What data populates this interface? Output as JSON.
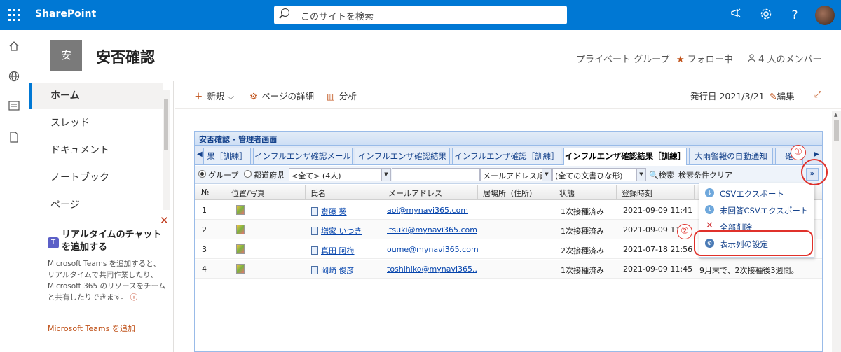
{
  "suitebar": {
    "brand": "SharePoint",
    "search_placeholder": "このサイトを検索",
    "icons": [
      "megaphone-icon",
      "gear-icon",
      "help-icon"
    ],
    "help_label": "?"
  },
  "site": {
    "logo_text": "安",
    "title": "安否確認",
    "group_type": "プライベート グループ",
    "follow": "フォロー中",
    "members": "4 人のメンバー"
  },
  "leftnav": {
    "items": [
      {
        "label": "ホーム",
        "active": true
      },
      {
        "label": "スレッド"
      },
      {
        "label": "ドキュメント"
      },
      {
        "label": "ノートブック"
      },
      {
        "label": "ページ"
      }
    ],
    "teams": {
      "title": "リアルタイムのチャットを追加する",
      "description": "Microsoft Teams を追加すると、リアルタイムで共同作業したり、Microsoft 365 のリソースをチームと共有したりできます。",
      "info_glyph": "ⓘ",
      "link": "Microsoft Teams を追加"
    }
  },
  "commandbar": {
    "new_label": "新規",
    "details_label": "ページの詳細",
    "analytics_label": "分析",
    "published": "発行日 2021/3/21",
    "edit_label": "編集"
  },
  "panel": {
    "title": "安否確認 - 管理者画面",
    "tabs": [
      "果［訓練］",
      "インフルエンザ確認メール",
      "インフルエンザ確認結果",
      "インフルエンザ確認［訓練］",
      "インフルエンザ確認結果［訓練］",
      "大雨警報の自動通知",
      "確"
    ],
    "active_tab_index": 4,
    "toolbar": {
      "radio_group": "グループ",
      "radio_pref": "都道府県",
      "combo_group": "<全て> (4人)",
      "combo_text": "",
      "combo_sort": "メールアドレス順",
      "combo_doc": "(全ての文書ひな形)",
      "search_btn": "検索",
      "clear_btn": "検索条件クリア",
      "more": "»"
    },
    "columns": [
      "№",
      "位置/写真",
      "氏名",
      "メールアドレス",
      "居場所（住所）",
      "状態",
      "登録時刻"
    ],
    "rows": [
      {
        "no": "1",
        "name": "齋藤 葵",
        "email": "aoi@mynavi365.com",
        "address": "",
        "status": "1次接種済み",
        "time": "2021-09-09 11:41...",
        "note": ""
      },
      {
        "no": "2",
        "name": "増家 いつき",
        "email": "itsuki@mynavi365.com",
        "address": "",
        "status": "1次接種済み",
        "time": "2021-09-09 11:41...",
        "note": ""
      },
      {
        "no": "3",
        "name": "真田 阿梅",
        "email": "oume@mynavi365.com",
        "address": "",
        "status": "2次接種済み",
        "time": "2021-07-18 21:56...",
        "note": ""
      },
      {
        "no": "4",
        "name": "岡崎 俊彦",
        "email": "toshihiko@mynavi365....",
        "address": "",
        "status": "1次接種済み",
        "time": "2021-09-09 11:45...",
        "note": "9月末で、2次接種後3週間。"
      }
    ],
    "menu": [
      {
        "label": "CSVエクスポート",
        "icon": "export-icon"
      },
      {
        "label": "未回答CSVエクスポート",
        "icon": "export-icon"
      },
      {
        "label": "全部削除",
        "icon": "delete-icon"
      },
      {
        "label": "表示列の設定",
        "icon": "gear-icon"
      }
    ]
  },
  "annotations": {
    "callout1": "①",
    "callout2": "②"
  }
}
